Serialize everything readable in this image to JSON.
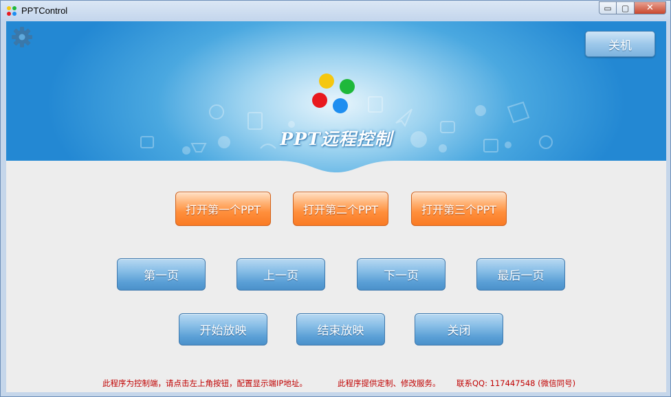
{
  "window": {
    "title": "PPTControl",
    "controls": {
      "minimize": "▭",
      "maximize": "▢",
      "close": "✕"
    }
  },
  "header": {
    "settings_icon": "gear-icon",
    "shutdown_label": "关机",
    "banner_title": "PPT远程控制",
    "logo_colors": [
      "#f5c70f",
      "#1eb83a",
      "#e8191e",
      "#1e8ef0"
    ]
  },
  "buttons": {
    "open_ppt": [
      "打开第一个PPT",
      "打开第二个PPT",
      "打开第三个PPT"
    ],
    "navigation": [
      "第一页",
      "上一页",
      "下一页",
      "最后一页"
    ],
    "playback": [
      "开始放映",
      "结束放映",
      "关闭"
    ]
  },
  "footer": {
    "hint": "此程序为控制端，请点击左上角按钮，配置显示端IP地址。",
    "service": "此程序提供定制、修改服务。",
    "contact": "联系QQ: 117447548 (微信同号)"
  },
  "colors": {
    "accent_orange": "#ff8f3c",
    "accent_blue": "#5a9fd6",
    "footer_text": "#c00000"
  }
}
